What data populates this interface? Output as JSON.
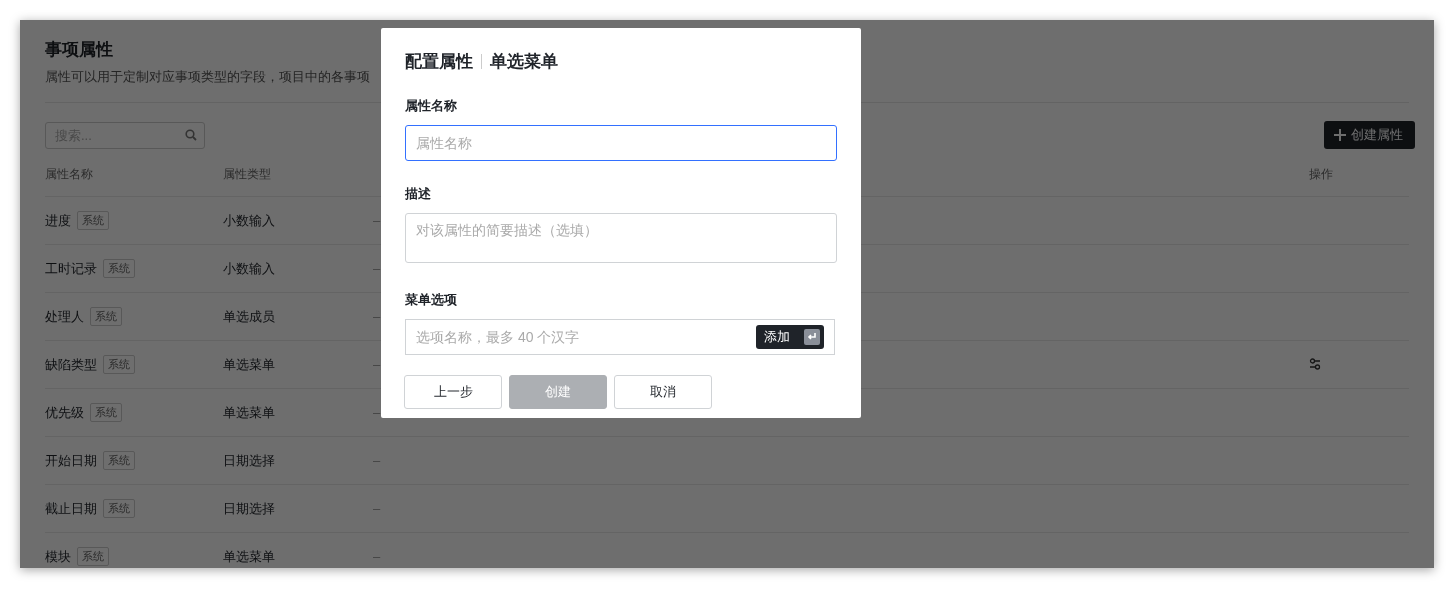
{
  "page": {
    "title": "事项属性",
    "description": "属性可以用于定制对应事项类型的字段，项目中的各事项",
    "search": {
      "placeholder": "搜索..."
    },
    "create_button": "创建属性"
  },
  "table": {
    "columns": [
      {
        "label": "属性名称"
      },
      {
        "label": "属性类型"
      },
      {
        "label": "操作"
      }
    ],
    "rows": [
      {
        "name": "进度",
        "tag": "系统",
        "type": "小数输入",
        "description": "–",
        "show_action": false
      },
      {
        "name": "工时记录",
        "tag": "系统",
        "type": "小数输入",
        "description": "–",
        "show_action": false
      },
      {
        "name": "处理人",
        "tag": "系统",
        "type": "单选成员",
        "description": "–",
        "show_action": false
      },
      {
        "name": "缺陷类型",
        "tag": "系统",
        "type": "单选菜单",
        "description": "–",
        "show_action": true
      },
      {
        "name": "优先级",
        "tag": "系统",
        "type": "单选菜单",
        "description": "–",
        "show_action": false
      },
      {
        "name": "开始日期",
        "tag": "系统",
        "type": "日期选择",
        "description": "–",
        "show_action": false
      },
      {
        "name": "截止日期",
        "tag": "系统",
        "type": "日期选择",
        "description": "–",
        "show_action": false
      },
      {
        "name": "模块",
        "tag": "系统",
        "type": "单选菜单",
        "description": "–",
        "show_action": false
      }
    ]
  },
  "dialog": {
    "title": "配置属性",
    "subtitle": "单选菜单",
    "fields": [
      {
        "kind": "input",
        "label": "属性名称",
        "placeholder": "属性名称",
        "focused": true
      },
      {
        "kind": "textarea",
        "label": "描述",
        "placeholder": "对该属性的简要描述（选填）",
        "focused": false
      },
      {
        "kind": "option",
        "label": "菜单选项",
        "placeholder": "选项名称，最多 40 个汉字",
        "focused": false,
        "add_button": "添加"
      }
    ],
    "buttons": [
      {
        "label": "上一步",
        "kind": "default",
        "disabled": false
      },
      {
        "label": "创建",
        "kind": "primary",
        "disabled": true
      },
      {
        "label": "取消",
        "kind": "default",
        "disabled": false
      }
    ]
  }
}
